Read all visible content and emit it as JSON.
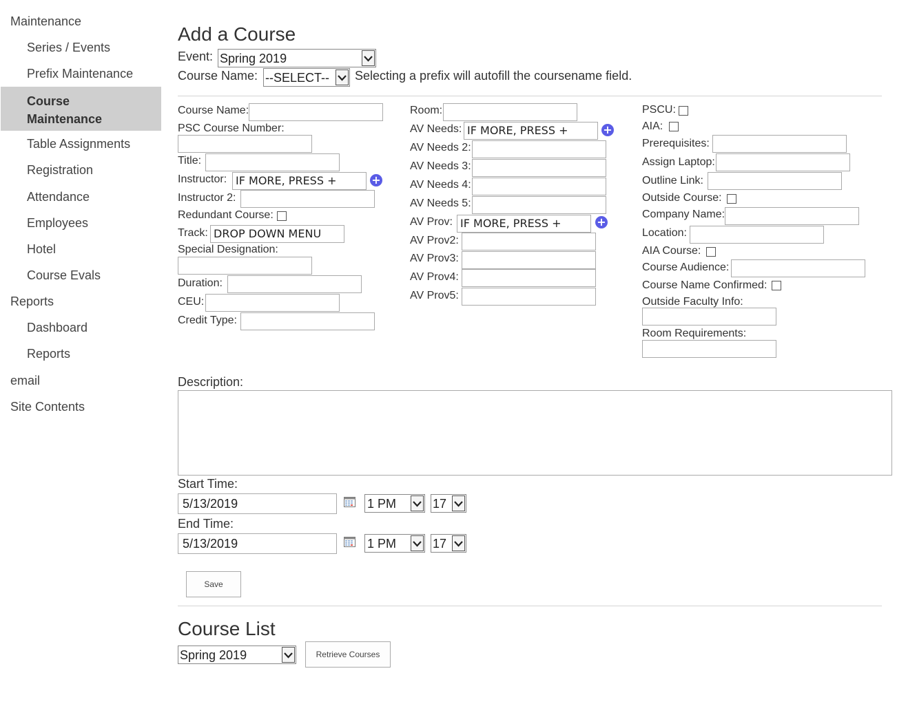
{
  "sidebar": {
    "items": [
      {
        "label": "Maintenance"
      },
      {
        "label": "Series / Events"
      },
      {
        "label": "Prefix Maintenance"
      },
      {
        "label_line1": "Course",
        "label_line2": "Maintenance"
      },
      {
        "label": "Table Assignments"
      },
      {
        "label": "Registration"
      },
      {
        "label": "Attendance"
      },
      {
        "label": "Employees"
      },
      {
        "label": "Hotel"
      },
      {
        "label": "Course Evals"
      },
      {
        "label": "Reports"
      },
      {
        "label": "Dashboard"
      },
      {
        "label": "Reports"
      },
      {
        "label": "email"
      },
      {
        "label": "Site Contents"
      }
    ]
  },
  "add_course": {
    "title": "Add a Course",
    "event_label": "Event:",
    "event_value": "Spring 2019",
    "course_name_label": "Course Name:",
    "course_name_value": "--SELECT--",
    "prefix_hint": "Selecting a prefix will autofill the coursename field."
  },
  "form": {
    "col1": {
      "course_name": "Course Name:",
      "psc_course_number": "PSC Course Number:",
      "title": "Title:",
      "instructor": "Instructor:",
      "instructor_value": "IF MORE, PRESS +",
      "instructor2": "Instructor 2:",
      "redundant_course": "Redundant Course:",
      "track": "Track:",
      "track_value": "DROP DOWN MENU",
      "special_designation": "Special Designation:",
      "duration": "Duration:",
      "ceu": "CEU:",
      "credit_type": "Credit Type:"
    },
    "col2": {
      "room": "Room:",
      "av_needs": "AV Needs:",
      "av_needs_value": "IF MORE, PRESS +",
      "av_needs2": "AV Needs 2:",
      "av_needs3": "AV Needs 3:",
      "av_needs4": "AV Needs 4:",
      "av_needs5": "AV Needs 5:",
      "av_prov": "AV Prov:",
      "av_prov_value": "IF MORE, PRESS +",
      "av_prov2": "AV Prov2:",
      "av_prov3": "AV Prov3:",
      "av_prov4": "AV Prov4:",
      "av_prov5": "AV Prov5:"
    },
    "col3": {
      "pscu": "PSCU:",
      "aia": "AIA:",
      "prerequisites": "Prerequisites:",
      "assign_laptop": "Assign Laptop:",
      "outline_link": "Outline Link:",
      "outside_course": "Outside Course:",
      "company_name": "Company Name:",
      "location": "Location:",
      "aia_course": "AIA Course:",
      "course_audience": "Course Audience:",
      "course_name_confirmed": "Course Name Confirmed:",
      "outside_faculty_info": "Outside Faculty Info:",
      "room_requirements": "Room Requirements:"
    },
    "description_label": "Description:",
    "start_time_label": "Start Time:",
    "start_date": "5/13/2019",
    "start_hour": "1 PM",
    "start_minute": "17",
    "end_time_label": "End Time:",
    "end_date": "5/13/2019",
    "end_hour": "1 PM",
    "end_minute": "17",
    "save_label": "Save"
  },
  "course_list": {
    "title": "Course List",
    "event_value": "Spring 2019",
    "retrieve_label": "Retrieve Courses"
  },
  "colors": {
    "active_nav_bg": "#cfcfcf",
    "plus_icon": "#5a5ce6"
  }
}
